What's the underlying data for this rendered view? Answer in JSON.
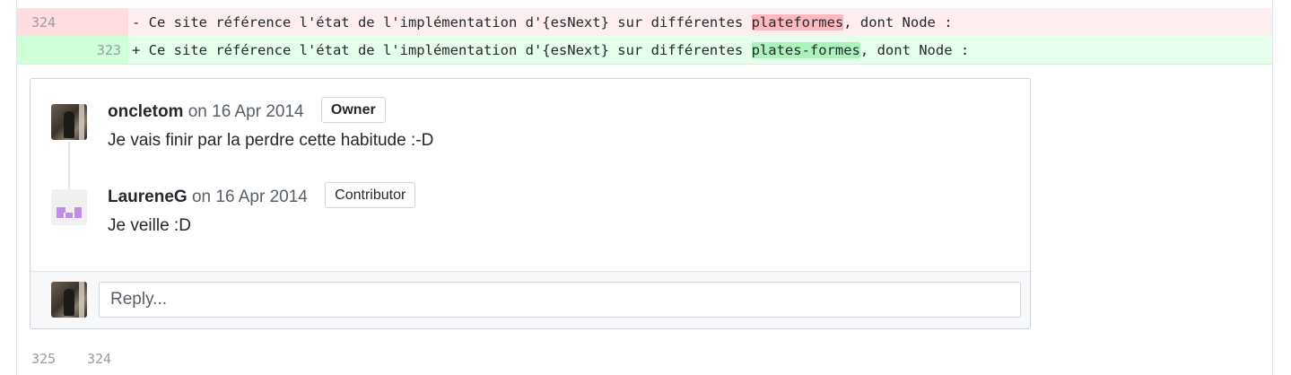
{
  "diff": {
    "deleted_line": {
      "old_num": "324",
      "new_num": "",
      "marker": "-",
      "prefix": " Ce site référence l'état de l'implémentation d'{esNext} sur différentes ",
      "highlight": "plateformes",
      "suffix": ", dont Node :"
    },
    "added_line": {
      "old_num": "",
      "new_num": "323",
      "marker": "+",
      "prefix": " Ce site référence l'état de l'implémentation d'{esNext} sur différentes ",
      "highlight": "plates-formes",
      "suffix": ", dont Node :"
    },
    "context_line": {
      "old_num": "325",
      "new_num": "324"
    }
  },
  "thread": {
    "comments": [
      {
        "author": "oncletom",
        "date": "on 16 Apr 2014",
        "badge": "Owner",
        "body": "Je vais finir par la perdre cette habitude :-D",
        "avatar_icon": "user-photo-icon"
      },
      {
        "author": "LaureneG",
        "date": "on 16 Apr 2014",
        "badge": "Contributor",
        "body": "Je veille :D",
        "avatar_icon": "identicon-icon"
      }
    ],
    "reply": {
      "placeholder": "Reply..."
    }
  },
  "colors": {
    "deleted_bg": "#ffeef0",
    "deleted_highlight": "#fdb8c0",
    "added_bg": "#e6ffed",
    "added_highlight": "#acf2bd",
    "identicon": "#c38de6"
  }
}
